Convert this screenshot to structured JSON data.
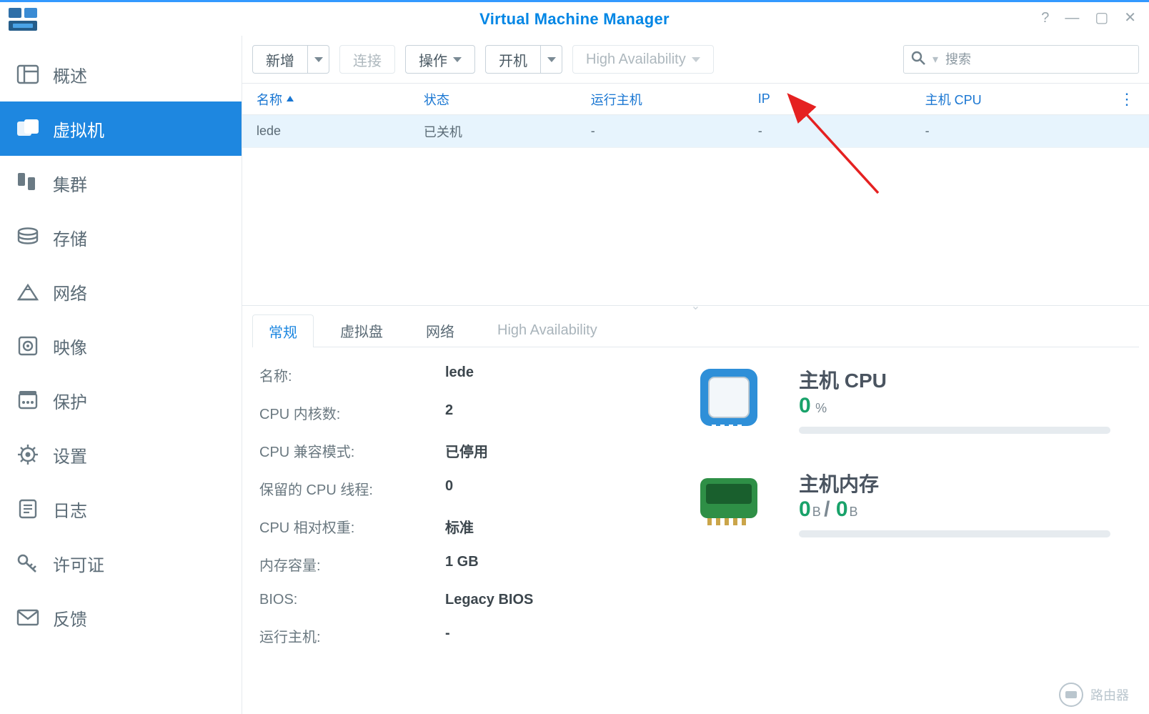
{
  "window": {
    "title": "Virtual Machine Manager"
  },
  "sidebar": {
    "items": [
      {
        "label": "概述"
      },
      {
        "label": "虚拟机"
      },
      {
        "label": "集群"
      },
      {
        "label": "存储"
      },
      {
        "label": "网络"
      },
      {
        "label": "映像"
      },
      {
        "label": "保护"
      },
      {
        "label": "设置"
      },
      {
        "label": "日志"
      },
      {
        "label": "许可证"
      },
      {
        "label": "反馈"
      }
    ]
  },
  "toolbar": {
    "add": "新增",
    "connect": "连接",
    "action": "操作",
    "poweron": "开机",
    "ha": "High Availability",
    "search_placeholder": "搜索"
  },
  "table": {
    "headers": {
      "name": "名称",
      "status": "状态",
      "host": "运行主机",
      "ip": "IP",
      "hostcpu": "主机 CPU"
    },
    "rows": [
      {
        "name": "lede",
        "status": "已关机",
        "host": "-",
        "ip": "-",
        "hostcpu": "-"
      }
    ]
  },
  "detail": {
    "tabs": {
      "general": "常规",
      "vdisk": "虚拟盘",
      "network": "网络",
      "ha": "High Availability"
    },
    "kv": {
      "name_k": "名称:",
      "name_v": "lede",
      "cores_k": "CPU 内核数:",
      "cores_v": "2",
      "compat_k": "CPU 兼容模式:",
      "compat_v": "已停用",
      "reserved_k": "保留的 CPU 线程:",
      "reserved_v": "0",
      "weight_k": "CPU 相对权重:",
      "weight_v": "标准",
      "mem_k": "内存容量:",
      "mem_v": "1 GB",
      "bios_k": "BIOS:",
      "bios_v": "Legacy BIOS",
      "host_k": "运行主机:",
      "host_v": "-"
    },
    "cards": {
      "cpu_title": "主机 CPU",
      "cpu_val": "0",
      "cpu_unit": "%",
      "mem_title": "主机内存",
      "mem_a": "0",
      "mem_a_unit": "B",
      "mem_sep": " / ",
      "mem_b": "0",
      "mem_b_unit": "B"
    }
  },
  "footer": {
    "logo_text": "路由器"
  }
}
